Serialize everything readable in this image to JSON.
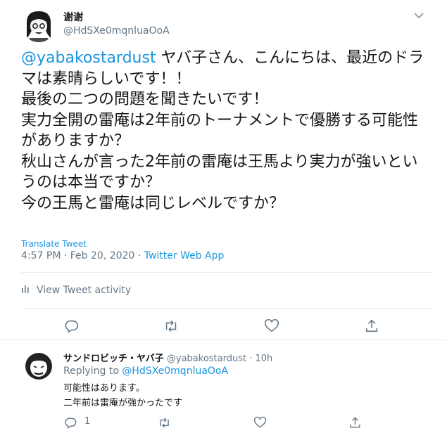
{
  "tweet": {
    "display_name": "谢谢",
    "handle": "@HdSXe0mqnluaOoA",
    "mention": "@yabakostardust",
    "text_after_mention": " ヤバ子さん、こんにちは、最近のドラマは素晴らしいです！！\n最後の二つの問題を聞きたいです！\n実力全開の雷庵は2年前のトーナメントで優勝する可能性がありますか？\n秋山さんが言った2年前の雷庵は王馬より実力が強いというのは本当ですか？\n今の王馬と雷庵は同じレベルですか？",
    "translate_label": "Translate Tweet",
    "timestamp": "4:57 PM · Feb 20, 2020 · ",
    "source_app": "Twitter Web App",
    "activity_label": "View Tweet activity"
  },
  "reply": {
    "display_name": "サンドロビッチ・ヤバ子",
    "handle_time": " @yabakostardust · 10h",
    "replying_prefix": "Replying to ",
    "replying_to": "@HdSXe0mqnluaOoA",
    "text": "可能性はあります。\n二年前は雷庵が強かったです",
    "reply_count": "1"
  },
  "colors": {
    "accent": "#1b95e0",
    "secondary_text": "#657786",
    "divider": "#e6ecf0"
  },
  "icons": [
    "caret-down-icon",
    "stats-icon",
    "reply-icon",
    "retweet-icon",
    "like-icon",
    "share-icon"
  ]
}
